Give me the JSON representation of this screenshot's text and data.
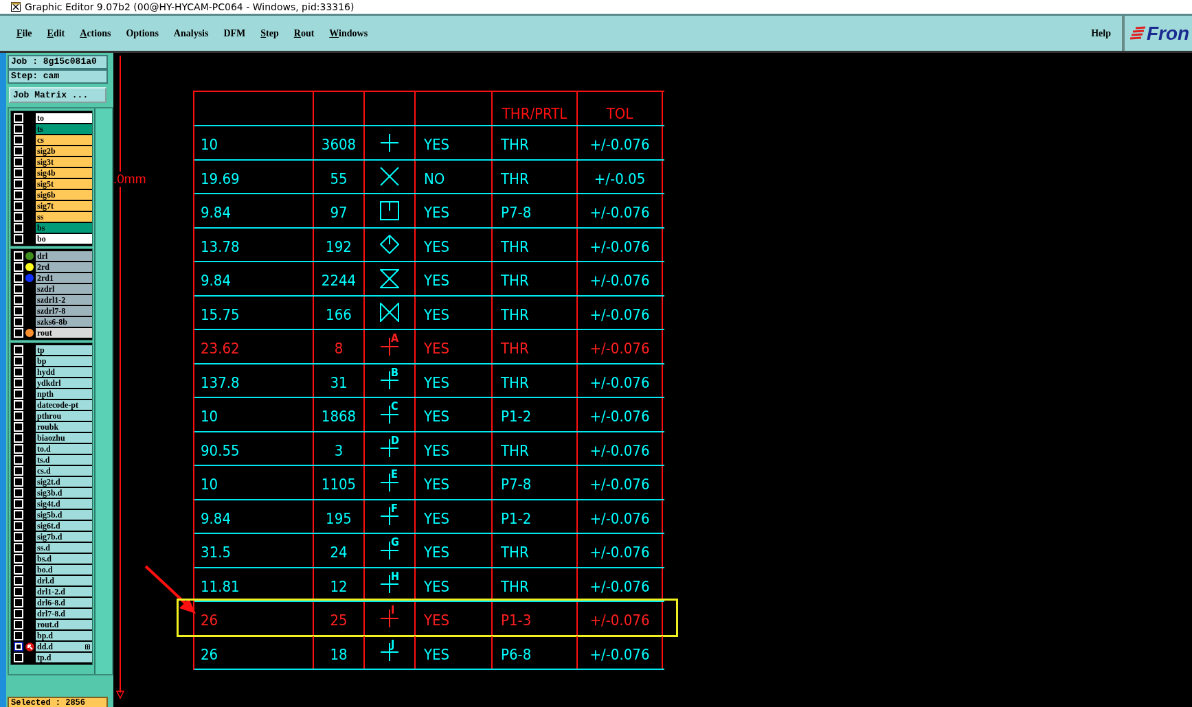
{
  "window": {
    "title": "Graphic Editor 9.07b2 (00@HY-HYCAM-PC064 - Windows, pid:33316)"
  },
  "menu": [
    {
      "label": "File",
      "underlined": true
    },
    {
      "label": "Edit",
      "underlined": true
    },
    {
      "label": "Actions",
      "underlined": true
    },
    {
      "label": "Options",
      "underlined": false
    },
    {
      "label": "Analysis",
      "underlined": false
    },
    {
      "label": "DFM",
      "underlined": false
    },
    {
      "label": "Step",
      "underlined": true
    },
    {
      "label": "Rout",
      "underlined": true
    },
    {
      "label": "Windows",
      "underlined": true
    }
  ],
  "help": "Help",
  "logo": "Fron",
  "panel": {
    "job": "Job : 8g15c081a0",
    "step": "Step: cam",
    "matrix_button": "Job Matrix ...",
    "selected": "Selected : 2856",
    "groups": [
      [
        {
          "name": "to",
          "color": "#ffffff",
          "active": false
        },
        {
          "name": "ts",
          "color": "#009a78",
          "active": false
        },
        {
          "name": "cs",
          "color": "#ffc857",
          "active": false
        },
        {
          "name": "sig2b",
          "color": "#ffc857",
          "active": false
        },
        {
          "name": "sig3t",
          "color": "#ffc857",
          "active": false
        },
        {
          "name": "sig4b",
          "color": "#ffc857",
          "active": false
        },
        {
          "name": "sig5t",
          "color": "#ffc857",
          "active": false
        },
        {
          "name": "sig6b",
          "color": "#ffc857",
          "active": false
        },
        {
          "name": "sig7t",
          "color": "#ffc857",
          "active": false
        },
        {
          "name": "ss",
          "color": "#ffc857",
          "active": false
        },
        {
          "name": "bs",
          "color": "#009a78",
          "active": false
        },
        {
          "name": "bo",
          "color": "#ffffff",
          "active": false
        }
      ],
      [
        {
          "name": "drl",
          "color": "#9eb4bd",
          "dot": {
            "color": "#3f8f1f"
          },
          "active": false
        },
        {
          "name": "2rd",
          "color": "#9eb4bd",
          "dot": {
            "color": "#ffff20"
          },
          "active": false
        },
        {
          "name": "2rd1",
          "color": "#9eb4bd",
          "dot": {
            "color": "#1030ff"
          },
          "active": false
        },
        {
          "name": "szdrl",
          "color": "#9eb4bd",
          "active": false
        },
        {
          "name": "szdrl1-2",
          "color": "#9eb4bd",
          "active": false
        },
        {
          "name": "szdrl7-8",
          "color": "#9eb4bd",
          "active": false
        },
        {
          "name": "szks6-8b",
          "color": "#9eb4bd",
          "active": false
        },
        {
          "name": "rout",
          "color": "#d9d9d9",
          "dot": {
            "color": "#ff9030"
          },
          "active": false
        }
      ],
      [
        {
          "name": "tp",
          "color": "#a0dcdc",
          "active": false
        },
        {
          "name": "bp",
          "color": "#a0dcdc",
          "active": false
        },
        {
          "name": "hydd",
          "color": "#a0dcdc",
          "active": false
        },
        {
          "name": "ydkdrl",
          "color": "#a0dcdc",
          "active": false
        },
        {
          "name": "npth",
          "color": "#a0dcdc",
          "active": false
        },
        {
          "name": "datecode-pt",
          "color": "#a0dcdc",
          "active": false
        },
        {
          "name": "pthrou",
          "color": "#a0dcdc",
          "active": false
        },
        {
          "name": "roubk",
          "color": "#a0dcdc",
          "active": false
        },
        {
          "name": "biaozhu",
          "color": "#a0dcdc",
          "active": false
        },
        {
          "name": "to.d",
          "color": "#a0dcdc",
          "active": false
        },
        {
          "name": "ts.d",
          "color": "#a0dcdc",
          "active": false
        },
        {
          "name": "cs.d",
          "color": "#a0dcdc",
          "active": false
        },
        {
          "name": "sig2t.d",
          "color": "#a0dcdc",
          "active": false
        },
        {
          "name": "sig3b.d",
          "color": "#a0dcdc",
          "active": false
        },
        {
          "name": "sig4t.d",
          "color": "#a0dcdc",
          "active": false
        },
        {
          "name": "sig5b.d",
          "color": "#a0dcdc",
          "active": false
        },
        {
          "name": "sig6t.d",
          "color": "#a0dcdc",
          "active": false
        },
        {
          "name": "sig7b.d",
          "color": "#a0dcdc",
          "active": false
        },
        {
          "name": "ss.d",
          "color": "#a0dcdc",
          "active": false
        },
        {
          "name": "bs.d",
          "color": "#a0dcdc",
          "active": false
        },
        {
          "name": "bo.d",
          "color": "#a0dcdc",
          "active": false
        },
        {
          "name": "drl.d",
          "color": "#a0dcdc",
          "active": false
        },
        {
          "name": "drl1-2.d",
          "color": "#a0dcdc",
          "active": false
        },
        {
          "name": "drl6-8.d",
          "color": "#a0dcdc",
          "active": false
        },
        {
          "name": "drl7-8.d",
          "color": "#a0dcdc",
          "active": false
        },
        {
          "name": "rout.d",
          "color": "#a0dcdc",
          "active": false
        },
        {
          "name": "bp.d",
          "color": "#a0dcdc",
          "active": false
        },
        {
          "name": "dd.d",
          "color": "#a0dcdc",
          "active": true
        },
        {
          "name": "tp.d",
          "color": "#a0dcdc",
          "active": false
        }
      ]
    ]
  },
  "ruler_label": ".0mm",
  "table": {
    "columns": [
      "",
      "",
      "",
      "",
      "THR/PRTL",
      "TOL"
    ],
    "rows": [
      {
        "dia": "10",
        "count": "3608",
        "symbol": {
          "kind": "plus"
        },
        "plated": "YES",
        "type": "THR",
        "tol": "+/-0.076",
        "color": "#00ffff",
        "highlighted": false
      },
      {
        "dia": "19.69",
        "count": "55",
        "symbol": {
          "kind": "cross"
        },
        "plated": "NO",
        "type": "THR",
        "tol": "+/-0.05",
        "color": "#00ffff",
        "highlighted": false
      },
      {
        "dia": "9.84",
        "count": "97",
        "symbol": {
          "kind": "square"
        },
        "plated": "YES",
        "type": "P7-8",
        "tol": "+/-0.076",
        "color": "#00ffff",
        "highlighted": false
      },
      {
        "dia": "13.78",
        "count": "192",
        "symbol": {
          "kind": "diamond"
        },
        "plated": "YES",
        "type": "THR",
        "tol": "+/-0.076",
        "color": "#00ffff",
        "highlighted": false
      },
      {
        "dia": "9.84",
        "count": "2244",
        "symbol": {
          "kind": "hourglass"
        },
        "plated": "YES",
        "type": "THR",
        "tol": "+/-0.076",
        "color": "#00ffff",
        "highlighted": false
      },
      {
        "dia": "15.75",
        "count": "166",
        "symbol": {
          "kind": "bowtie"
        },
        "plated": "YES",
        "type": "THR",
        "tol": "+/-0.076",
        "color": "#00ffff",
        "highlighted": false
      },
      {
        "dia": "23.62",
        "count": "8",
        "symbol": {
          "kind": "plus",
          "letter": "A"
        },
        "plated": "YES",
        "type": "THR",
        "tol": "+/-0.076",
        "color": "#ff2020",
        "highlighted": false
      },
      {
        "dia": "137.8",
        "count": "31",
        "symbol": {
          "kind": "plus",
          "letter": "B"
        },
        "plated": "YES",
        "type": "THR",
        "tol": "+/-0.076",
        "color": "#00ffff",
        "highlighted": false
      },
      {
        "dia": "10",
        "count": "1868",
        "symbol": {
          "kind": "plus",
          "letter": "C"
        },
        "plated": "YES",
        "type": "P1-2",
        "tol": "+/-0.076",
        "color": "#00ffff",
        "highlighted": false
      },
      {
        "dia": "90.55",
        "count": "3",
        "symbol": {
          "kind": "plus",
          "letter": "D"
        },
        "plated": "YES",
        "type": "THR",
        "tol": "+/-0.076",
        "color": "#00ffff",
        "highlighted": false
      },
      {
        "dia": "10",
        "count": "1105",
        "symbol": {
          "kind": "plus",
          "letter": "E"
        },
        "plated": "YES",
        "type": "P7-8",
        "tol": "+/-0.076",
        "color": "#00ffff",
        "highlighted": false
      },
      {
        "dia": "9.84",
        "count": "195",
        "symbol": {
          "kind": "plus",
          "letter": "F"
        },
        "plated": "YES",
        "type": "P1-2",
        "tol": "+/-0.076",
        "color": "#00ffff",
        "highlighted": false
      },
      {
        "dia": "31.5",
        "count": "24",
        "symbol": {
          "kind": "plus",
          "letter": "G"
        },
        "plated": "YES",
        "type": "THR",
        "tol": "+/-0.076",
        "color": "#00ffff",
        "highlighted": false
      },
      {
        "dia": "11.81",
        "count": "12",
        "symbol": {
          "kind": "plus",
          "letter": "H"
        },
        "plated": "YES",
        "type": "THR",
        "tol": "+/-0.076",
        "color": "#00ffff",
        "highlighted": false
      },
      {
        "dia": "26",
        "count": "25",
        "symbol": {
          "kind": "plus",
          "letter": "I"
        },
        "plated": "YES",
        "type": "P1-3",
        "tol": "+/-0.076",
        "color": "#ff2020",
        "highlighted": true
      },
      {
        "dia": "26",
        "count": "18",
        "symbol": {
          "kind": "plus",
          "letter": "J"
        },
        "plated": "YES",
        "type": "P6-8",
        "tol": "+/-0.076",
        "color": "#00ffff",
        "highlighted": false
      }
    ]
  }
}
